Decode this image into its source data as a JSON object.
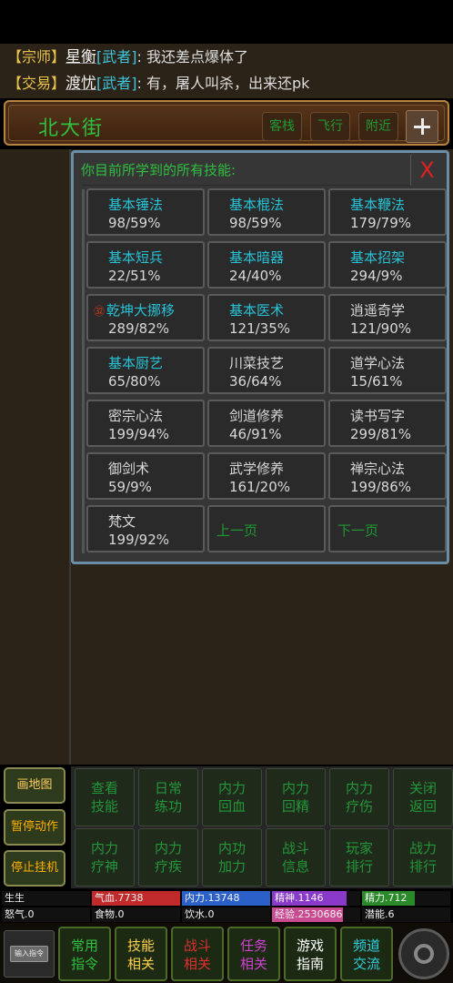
{
  "chat": [
    {
      "channel": "【宗师】",
      "name": "星衡",
      "rank": "[武者]",
      "message": ": 我还差点爆体了"
    },
    {
      "channel": "【交易】",
      "name": "渡忧",
      "rank": "[武者]",
      "message": ": 有，屠人叫杀，出来还pk"
    }
  ],
  "location": {
    "name": "北大街",
    "buttons": [
      "客栈",
      "飞行",
      "附近"
    ],
    "add_icon": "plus-icon"
  },
  "skills_panel": {
    "title": "你目前所学到的所有技能:",
    "close_label": "X",
    "skills": [
      {
        "name": "基本锤法",
        "value": "98/59%",
        "color": "cyan"
      },
      {
        "name": "基本棍法",
        "value": "98/59%",
        "color": "cyan"
      },
      {
        "name": "基本鞭法",
        "value": "179/79%",
        "color": "cyan"
      },
      {
        "name": "基本短兵",
        "value": "22/51%",
        "color": "cyan"
      },
      {
        "name": "基本暗器",
        "value": "24/40%",
        "color": "cyan"
      },
      {
        "name": "基本招架",
        "value": "294/9%",
        "color": "cyan"
      },
      {
        "name": "乾坤大挪移",
        "value": "289/82%",
        "color": "cyan",
        "badge": "㉜"
      },
      {
        "name": "基本医术",
        "value": "121/35%",
        "color": "cyan"
      },
      {
        "name": "逍遥奇学",
        "value": "121/90%",
        "color": "white"
      },
      {
        "name": "基本厨艺",
        "value": "65/80%",
        "color": "cyan"
      },
      {
        "name": "川菜技艺",
        "value": "36/64%",
        "color": "white"
      },
      {
        "name": "道学心法",
        "value": "15/61%",
        "color": "white"
      },
      {
        "name": "密宗心法",
        "value": "199/94%",
        "color": "white"
      },
      {
        "name": "剑道修养",
        "value": "46/91%",
        "color": "white"
      },
      {
        "name": "读书写字",
        "value": "299/81%",
        "color": "white"
      },
      {
        "name": "御剑术",
        "value": "59/9%",
        "color": "white"
      },
      {
        "name": "武学修养",
        "value": "161/20%",
        "color": "white"
      },
      {
        "name": "禅宗心法",
        "value": "199/86%",
        "color": "white"
      },
      {
        "name": "梵文",
        "value": "199/92%",
        "color": "white"
      }
    ],
    "prev_page": "上一页",
    "next_page": "下一页"
  },
  "side_buttons": [
    "画地图",
    "暂停动作",
    "停止挂机"
  ],
  "commands": [
    [
      "查看",
      "技能"
    ],
    [
      "日常",
      "练功"
    ],
    [
      "内力",
      "回血"
    ],
    [
      "内力",
      "回精"
    ],
    [
      "内力",
      "疗伤"
    ],
    [
      "关闭",
      "返回"
    ],
    [
      "内力",
      "疗神"
    ],
    [
      "内力",
      "疗疾"
    ],
    [
      "内功",
      "加力"
    ],
    [
      "战斗",
      "信息"
    ],
    [
      "玩家",
      "排行"
    ],
    [
      "战力",
      "排行"
    ]
  ],
  "stats": [
    {
      "label": "生生",
      "color": "#000000",
      "fill": 0
    },
    {
      "label": "气血.7738",
      "color": "#c02a2a",
      "fill": 1
    },
    {
      "label": "内力.13748",
      "color": "#2a60c8",
      "fill": 1
    },
    {
      "label": "精神.1146",
      "color": "#8a3ac8",
      "fill": 0.85
    },
    {
      "label": "精力.712",
      "color": "#2a8a2a",
      "fill": 0.6
    },
    {
      "label": "怒气.0",
      "color": "#000000",
      "fill": 0
    },
    {
      "label": "食物.0",
      "color": "#000000",
      "fill": 0
    },
    {
      "label": "饮水.0",
      "color": "#000000",
      "fill": 0
    },
    {
      "label": "经验.2530686",
      "color": "#c84a90",
      "fill": 0.8
    },
    {
      "label": "潜能.6",
      "color": "#000000",
      "fill": 0
    }
  ],
  "bottom_buttons": [
    {
      "l1": "常用",
      "l2": "指令",
      "color": "#2fbf3f"
    },
    {
      "l1": "技能",
      "l2": "相关",
      "color": "#ffd24a"
    },
    {
      "l1": "战斗",
      "l2": "相关",
      "color": "#e03030"
    },
    {
      "l1": "任务",
      "l2": "相关",
      "color": "#d040d0"
    },
    {
      "l1": "游戏",
      "l2": "指南",
      "color": "#ffffff"
    },
    {
      "l1": "频道",
      "l2": "交流",
      "color": "#2fd0e0"
    }
  ],
  "input_button_label": "输入指令",
  "settings_icon": "gear-icon"
}
